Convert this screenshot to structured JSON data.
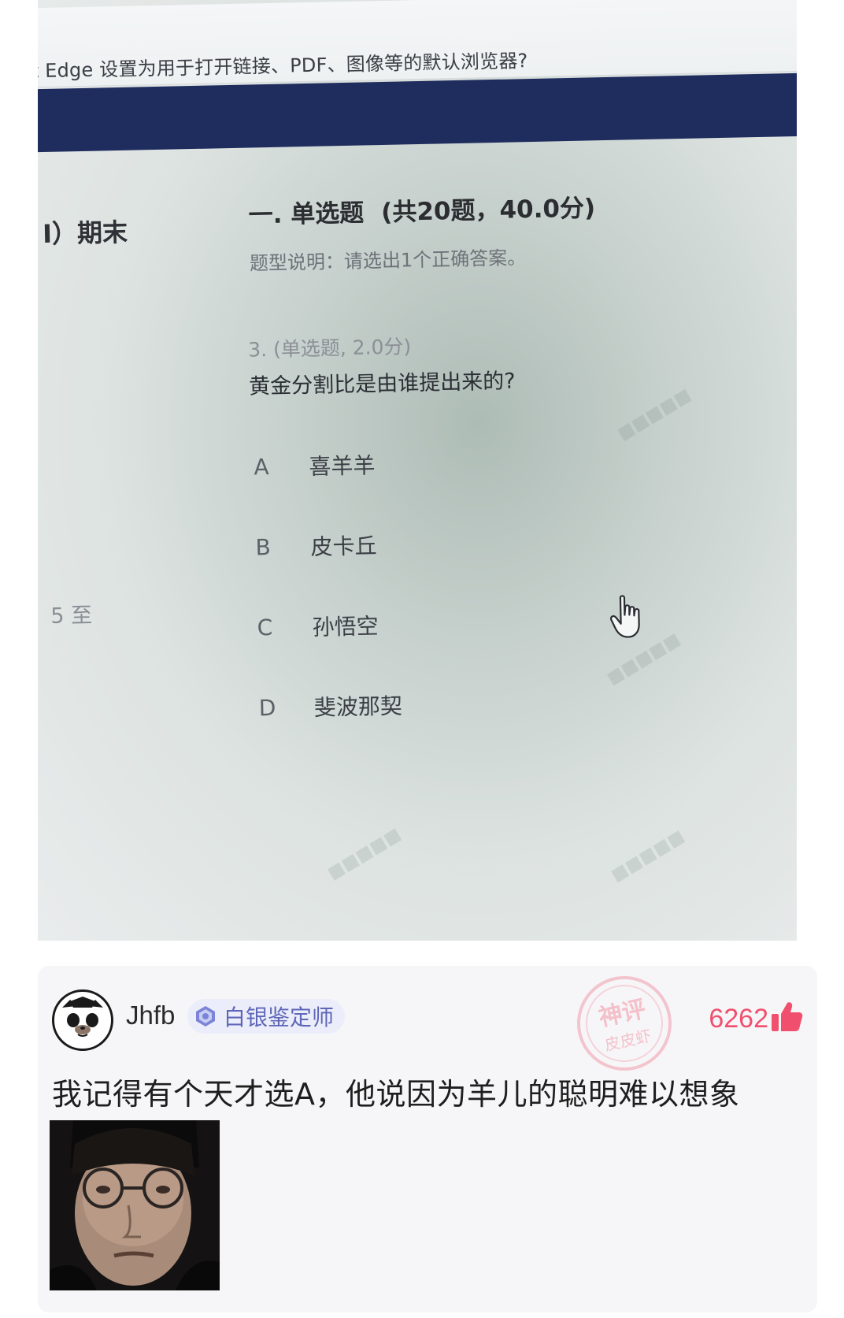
{
  "photo": {
    "edge_prompt": "t Edge 设置为用于打开链接、PDF、图像等的默认浏览器?",
    "course_title": "I）期末",
    "side_range": "5 至",
    "section": {
      "heading": "一. 单选题",
      "score": "(共20题，40.0分)",
      "description": "题型说明：请选出1个正确答案。"
    },
    "question": {
      "meta": "3. (单选题, 2.0分)",
      "text": "黄金分割比是由谁提出来的?",
      "options": [
        {
          "letter": "A",
          "text": "喜羊羊"
        },
        {
          "letter": "B",
          "text": "皮卡丘"
        },
        {
          "letter": "C",
          "text": "孙悟空"
        },
        {
          "letter": "D",
          "text": "斐波那契"
        }
      ]
    },
    "cursor_icon": "hand-pointer-icon"
  },
  "comment": {
    "username": "Jhfb",
    "badge": "白银鉴定师",
    "likes": "6262",
    "text": "我记得有个天才选A，他说因为羊儿的聪明难以想象",
    "stamp_top": "神评",
    "stamp_bottom": "皮皮虾",
    "accent_color": "#f0506e",
    "badge_color": "#5f66b8"
  }
}
